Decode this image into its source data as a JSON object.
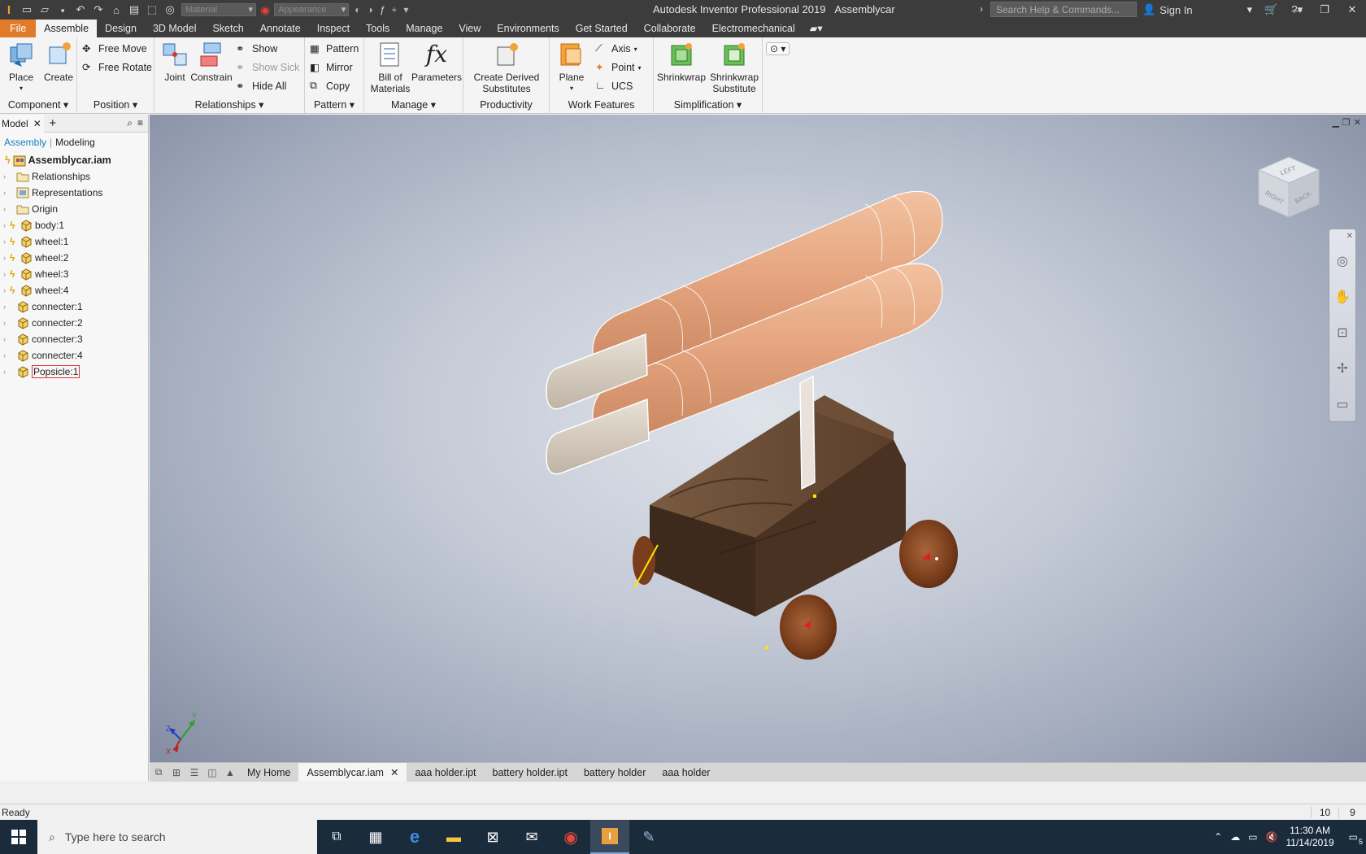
{
  "titlebar": {
    "material_placeholder": "Material",
    "appearance_placeholder": "Appearance",
    "app_title": "Autodesk Inventor Professional 2019",
    "doc_title": "Assemblycar",
    "help_search_placeholder": "Search Help & Commands...",
    "sign_in": "Sign In"
  },
  "menu_tabs": [
    "File",
    "Assemble",
    "Design",
    "3D Model",
    "Sketch",
    "Annotate",
    "Inspect",
    "Tools",
    "Manage",
    "View",
    "Environments",
    "Get Started",
    "Collaborate",
    "Electromechanical"
  ],
  "ribbon": {
    "component": {
      "title": "Component",
      "place": "Place",
      "create": "Create"
    },
    "position": {
      "title": "Position",
      "free_move": "Free Move",
      "free_rotate": "Free Rotate"
    },
    "relationships": {
      "title": "Relationships",
      "joint": "Joint",
      "constrain": "Constrain",
      "show": "Show",
      "show_sick": "Show Sick",
      "hide_all": "Hide All"
    },
    "pattern": {
      "title": "Pattern",
      "pattern": "Pattern",
      "mirror": "Mirror",
      "copy": "Copy"
    },
    "manage": {
      "title": "Manage",
      "bom": "Bill of\nMaterials",
      "parameters": "Parameters"
    },
    "productivity": {
      "title": "Productivity",
      "create_derived": "Create Derived\nSubstitutes"
    },
    "work_features": {
      "title": "Work Features",
      "plane": "Plane",
      "axis": "Axis",
      "point": "Point",
      "ucs": "UCS"
    },
    "simplification": {
      "title": "Simplification",
      "shrinkwrap": "Shrinkwrap",
      "shrinkwrap_sub": "Shrinkwrap\nSubstitute"
    }
  },
  "browser": {
    "tab": "Model",
    "subtab_assembly": "Assembly",
    "subtab_modeling": "Modeling",
    "root": "Assemblycar.iam",
    "items": [
      {
        "label": "Relationships",
        "icon": "folder-icon"
      },
      {
        "label": "Representations",
        "icon": "representations-icon"
      },
      {
        "label": "Origin",
        "icon": "folder-icon"
      },
      {
        "label": "body:1",
        "icon": "part-icon"
      },
      {
        "label": "wheel:1",
        "icon": "part-icon"
      },
      {
        "label": "wheel:2",
        "icon": "part-icon"
      },
      {
        "label": "wheel:3",
        "icon": "part-icon"
      },
      {
        "label": "wheel:4",
        "icon": "part-icon"
      },
      {
        "label": "connecter:1",
        "icon": "part-icon"
      },
      {
        "label": "connecter:2",
        "icon": "part-icon"
      },
      {
        "label": "connecter:3",
        "icon": "part-icon"
      },
      {
        "label": "connecter:4",
        "icon": "part-icon"
      },
      {
        "label": "Popsicle:1",
        "icon": "part-icon"
      }
    ]
  },
  "viewcube": {
    "top": "LEFT",
    "front": "RIGHT",
    "side": "BACK"
  },
  "triad": {
    "x": "X",
    "y": "Y",
    "z": "Z"
  },
  "doc_tabs": [
    "My Home",
    "Assemblycar.iam",
    "aaa holder.ipt",
    "battery holder.ipt",
    "battery holder",
    "aaa holder"
  ],
  "status": {
    "text": "Ready",
    "num1": "10",
    "num2": "9"
  },
  "taskbar": {
    "search_placeholder": "Type here to search",
    "time": "11:30 AM",
    "date": "11/14/2019",
    "notifications": "5"
  },
  "colors": {
    "accent": "#e07b2a",
    "assembly_blue": "#1a7fc1",
    "taskbar": "#1a2b3c"
  }
}
